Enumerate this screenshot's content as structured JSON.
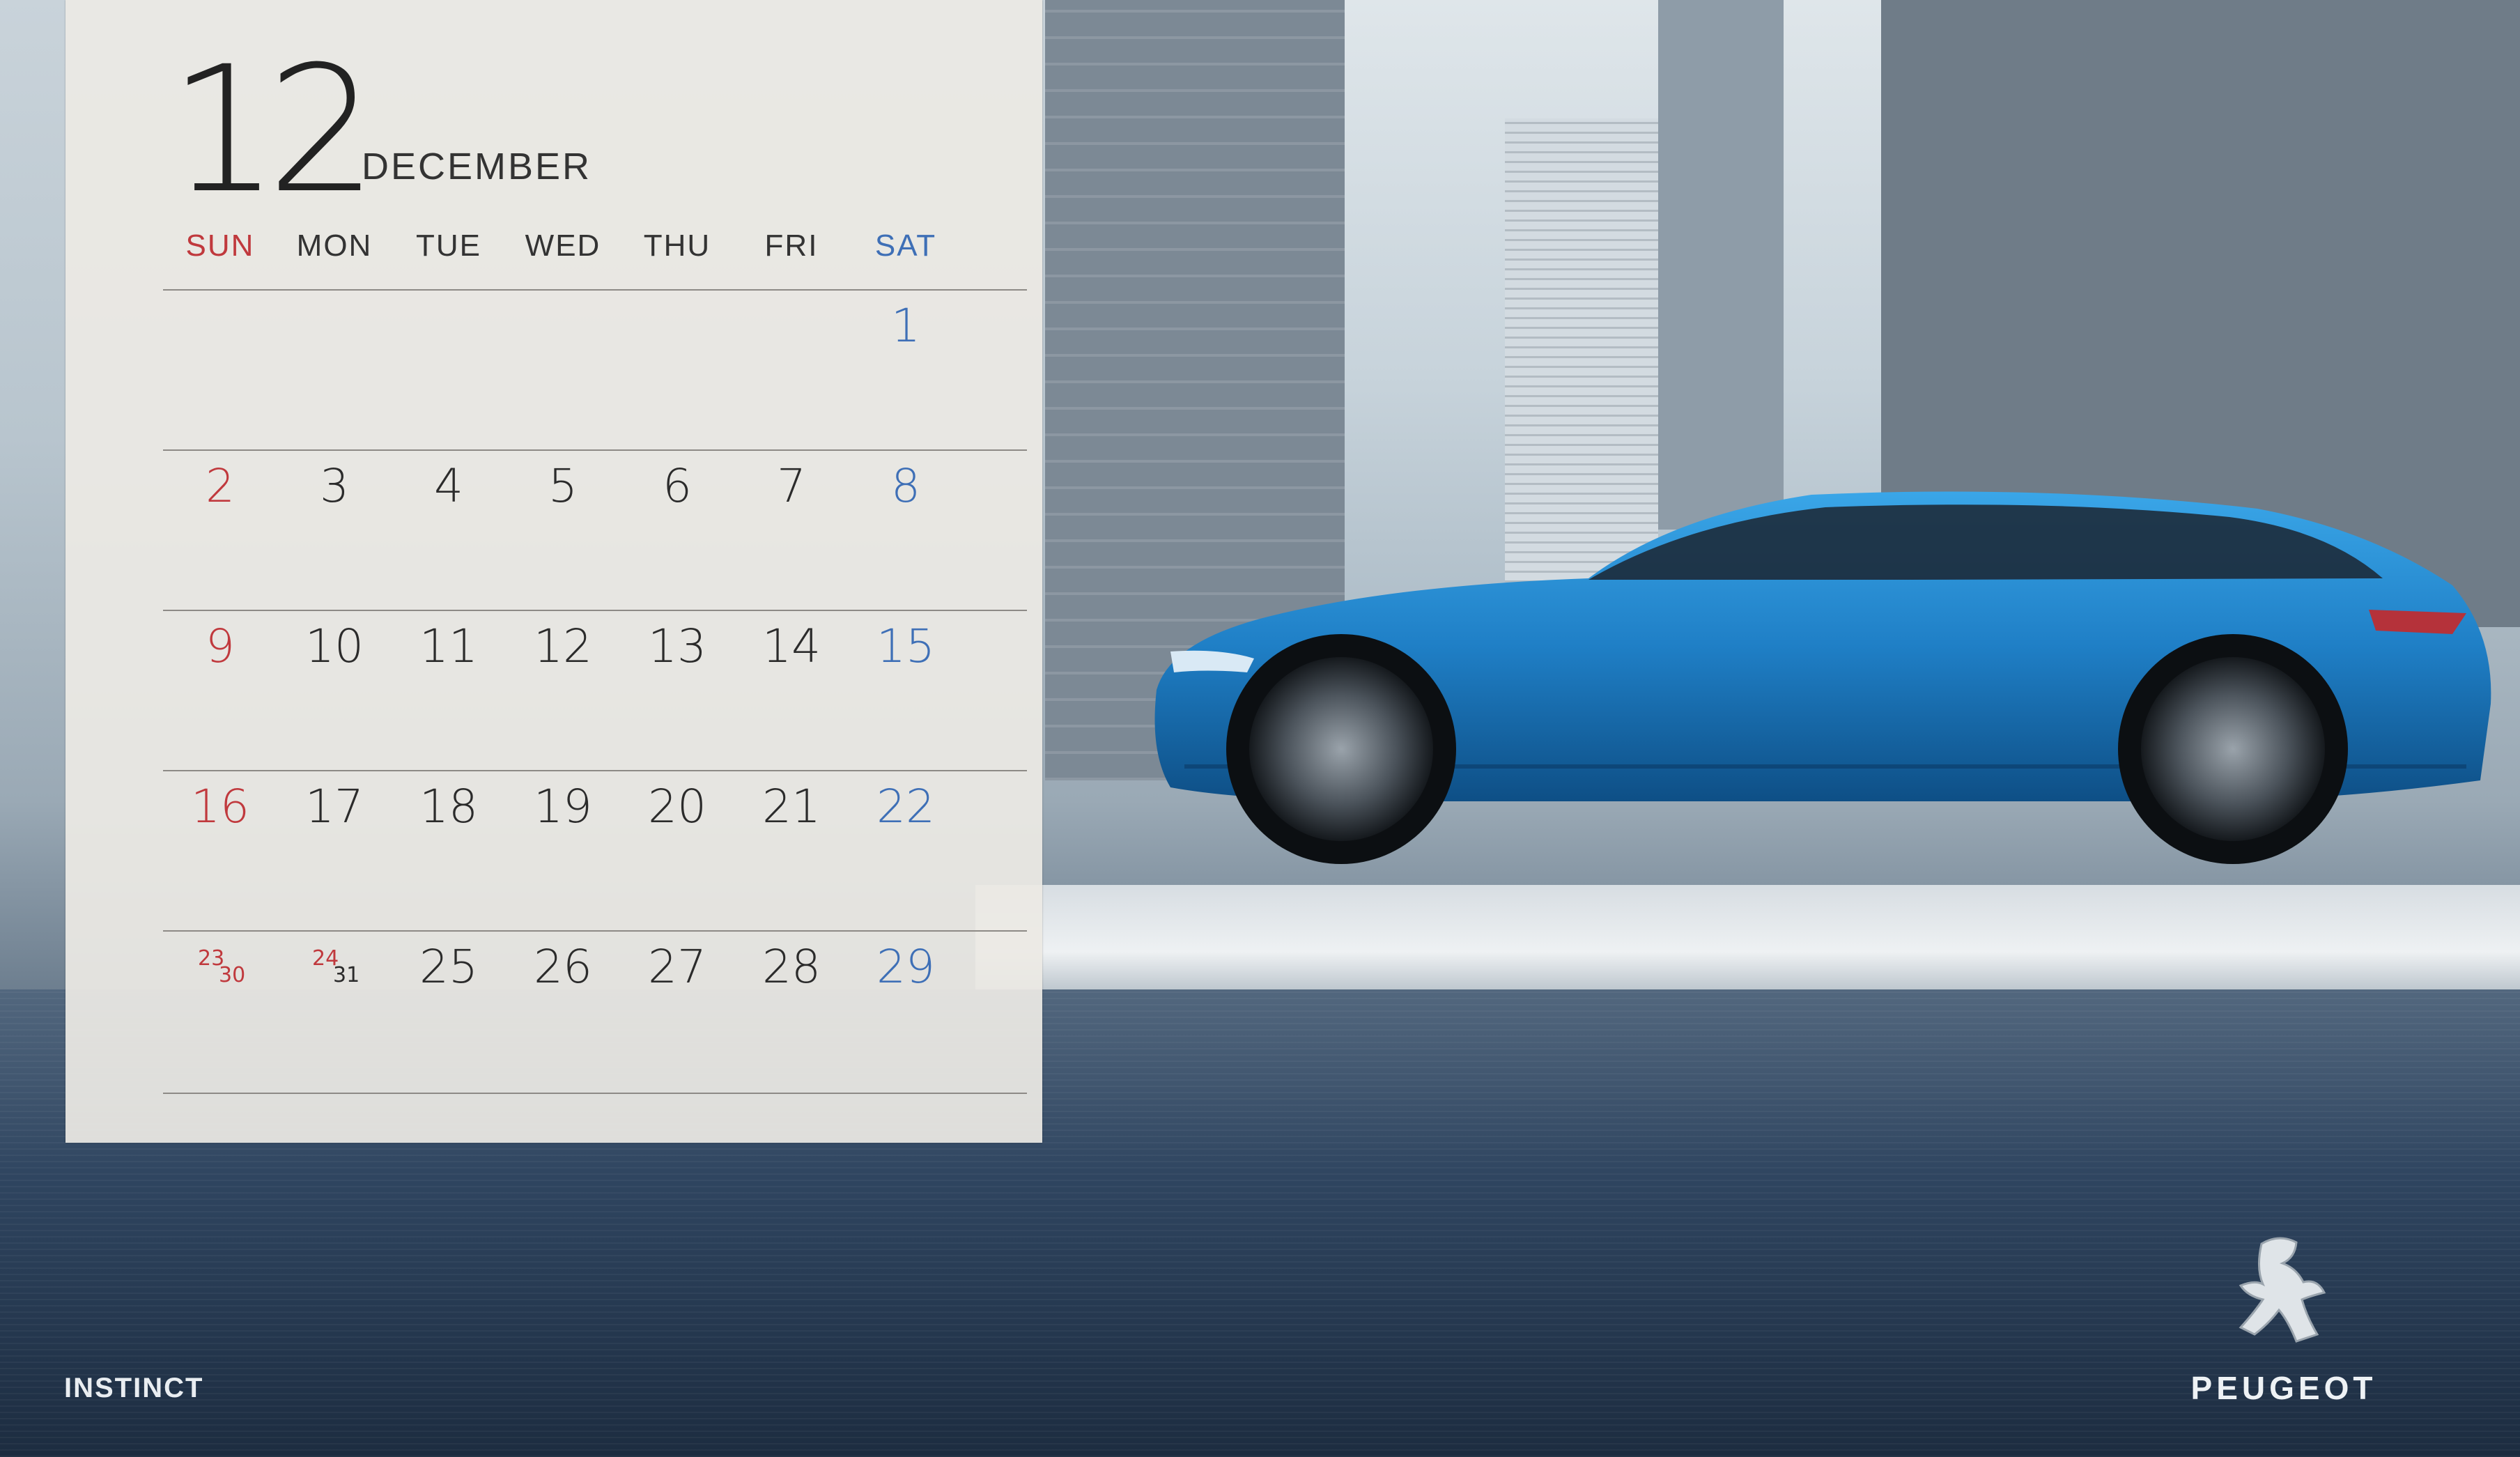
{
  "calendar": {
    "month_number": "12",
    "month_name": "DECEMBER",
    "weekdays": [
      "SUN",
      "MON",
      "TUE",
      "WED",
      "THU",
      "FRI",
      "SAT"
    ],
    "weeks": [
      [
        "",
        "",
        "",
        "",
        "",
        "",
        "1"
      ],
      [
        "2",
        "3",
        "4",
        "5",
        "6",
        "7",
        "8"
      ],
      [
        "9",
        "10",
        "11",
        "12",
        "13",
        "14",
        "15"
      ],
      [
        "16",
        "17",
        "18",
        "19",
        "20",
        "21",
        "22"
      ],
      [
        {
          "top": "23",
          "bottom": "30"
        },
        {
          "top": "24",
          "bottom": "31"
        },
        "25",
        "26",
        "27",
        "28",
        "29"
      ]
    ]
  },
  "footer": {
    "model_name": "INSTINCT",
    "brand": "PEUGEOT"
  },
  "colors": {
    "sunday": "#c0393d",
    "saturday": "#3e6fb6",
    "car": "#2a8fd4"
  },
  "icons": {
    "logo": "lion-logo-icon"
  }
}
